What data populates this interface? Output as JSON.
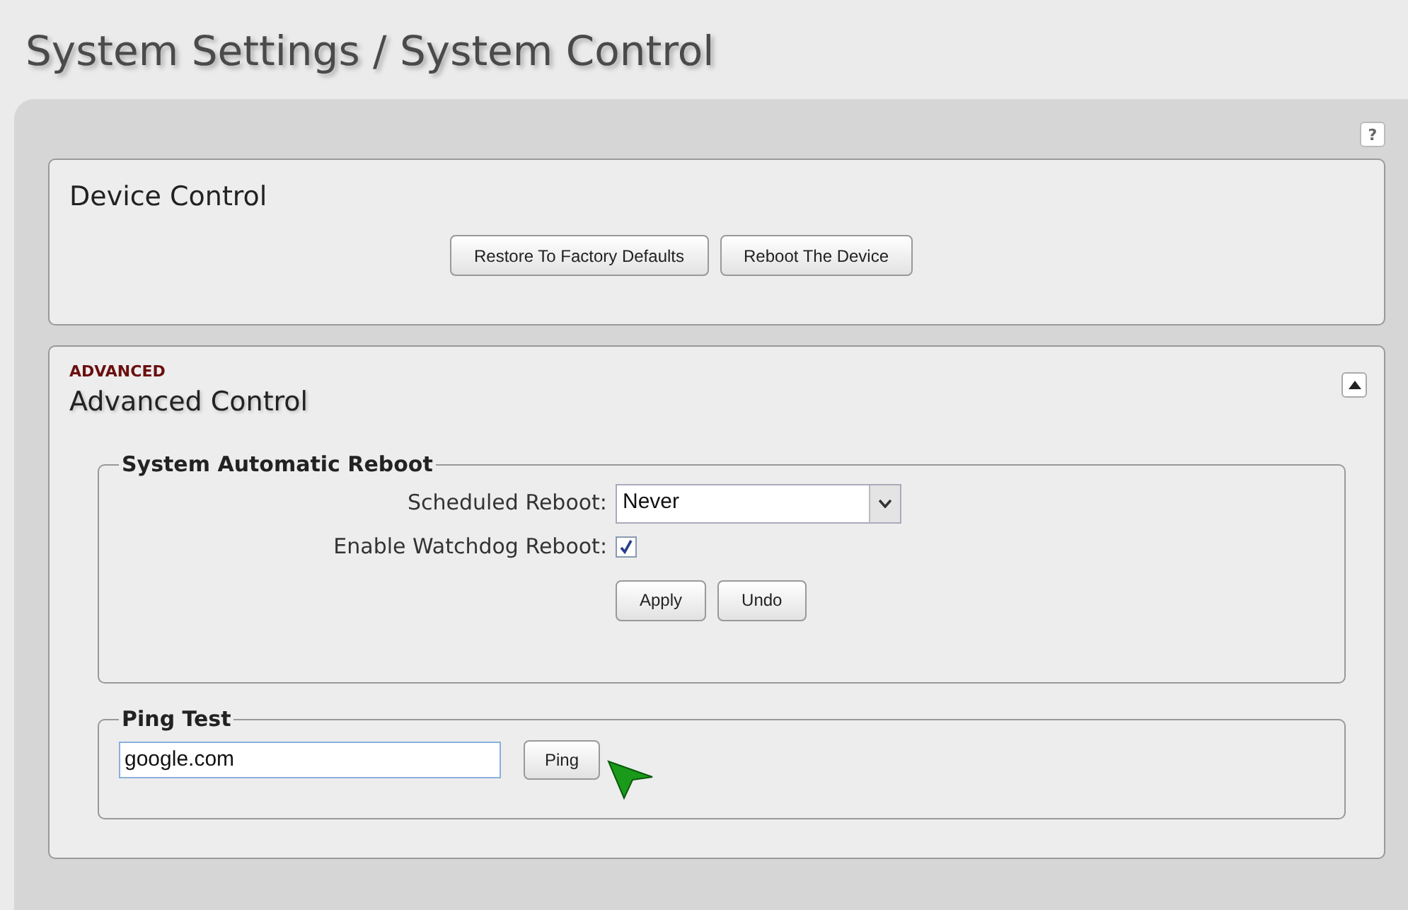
{
  "page_title": "System Settings / System Control",
  "help_button": {
    "label": "?"
  },
  "device_control": {
    "title": "Device Control",
    "buttons": [
      "Restore To Factory Defaults",
      "Reboot The Device"
    ]
  },
  "advanced_control": {
    "badge": "ADVANCED",
    "title": "Advanced Control",
    "expanded": true,
    "automatic_reboot": {
      "legend": "System Automatic Reboot",
      "fields": [
        {
          "kind": "select",
          "label": "Scheduled Reboot:",
          "value": "Never"
        },
        {
          "kind": "checkbox",
          "label": "Enable Watchdog Reboot:",
          "checked": true
        }
      ],
      "buttons": [
        "Apply",
        "Undo"
      ]
    },
    "ping_test": {
      "legend": "Ping Test",
      "host": "google.com",
      "button": "Ping"
    }
  }
}
